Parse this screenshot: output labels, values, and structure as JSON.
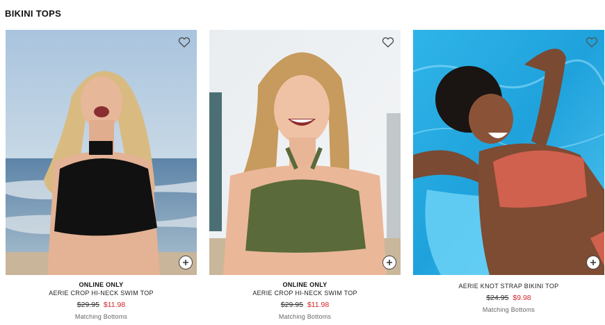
{
  "section": {
    "title": "BIKINI TOPS"
  },
  "products": [
    {
      "tag": "ONLINE ONLY",
      "name": "AERIE CROP HI-NECK SWIM TOP",
      "original_price": "$29.95",
      "sale_price": "$11.98",
      "link": "Matching Bottoms",
      "swimsuit_color": "#111111"
    },
    {
      "tag": "ONLINE ONLY",
      "name": "AERIE CROP HI-NECK SWIM TOP",
      "original_price": "$29.95",
      "sale_price": "$11.98",
      "link": "Matching Bottoms",
      "swimsuit_color": "#5a6a3a"
    },
    {
      "tag": "",
      "name": "AERIE KNOT STRAP BIKINI TOP",
      "original_price": "$24.95",
      "sale_price": "$9.98",
      "link": "Matching Bottoms",
      "swimsuit_color": "#d0614f"
    }
  ],
  "icons": {
    "favorite": "heart-outline-icon",
    "quick_add": "plus-circle-icon"
  },
  "colors": {
    "sale": "#d3252b",
    "text": "#222222",
    "muted": "#666666"
  }
}
